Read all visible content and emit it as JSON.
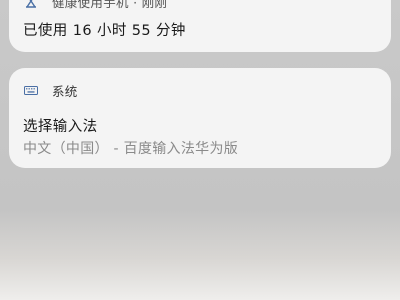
{
  "notifications": [
    {
      "app_name": "健康使用手机 · 刚刚",
      "app_icon": "hourglass-icon",
      "title": "已使用 16 小时 55 分钟"
    },
    {
      "app_name": "系统",
      "app_icon": "keyboard-icon",
      "title": "选择输入法",
      "subtitle": "中文（中国） - 百度输入法华为版"
    }
  ],
  "colors": {
    "background": "#c6c6c6",
    "card": "#f4f4f4",
    "title_text": "#1a1a1a",
    "subtitle_text": "#8a8a8a",
    "icon": "#4a6fa5"
  }
}
